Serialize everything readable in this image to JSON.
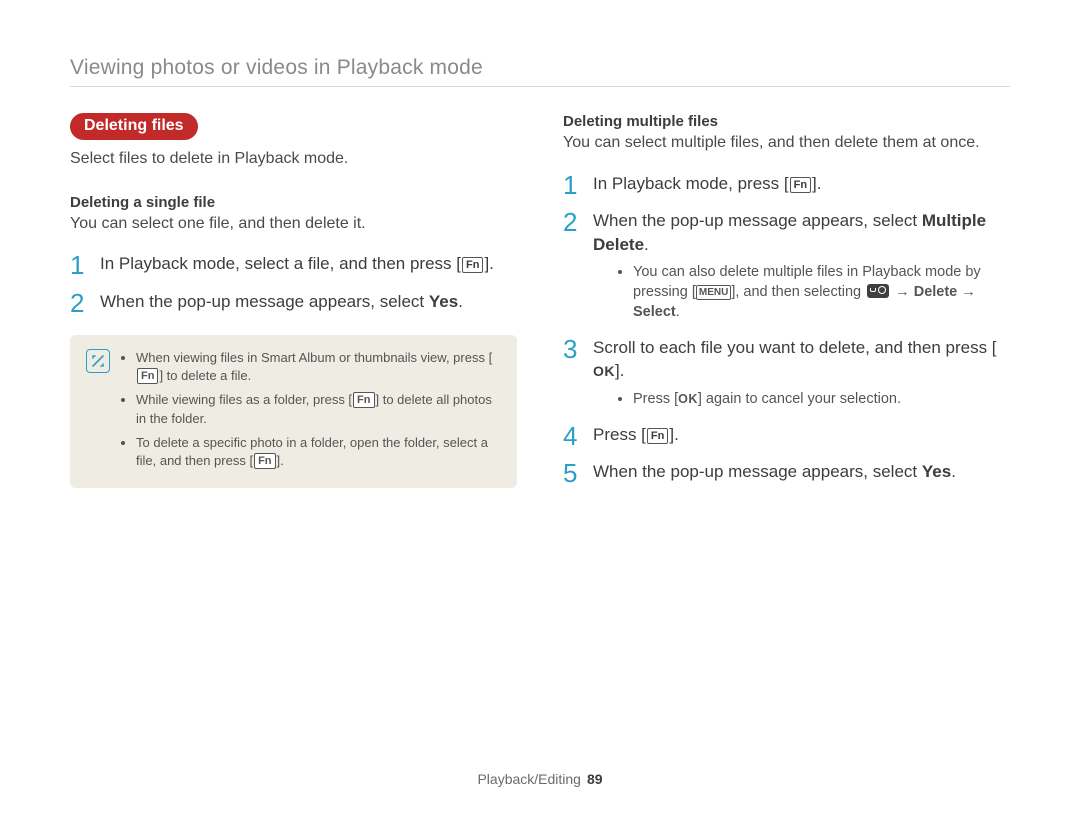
{
  "header": "Viewing photos or videos in Playback mode",
  "left": {
    "section_title": "Deleting files",
    "intro": "Select files to delete in Playback mode.",
    "sub1_title": "Deleting a single file",
    "sub1_text": "You can select one file, and then delete it.",
    "step1_a": "In Playback mode, select a file, and then press [",
    "step1_key": "Fn",
    "step1_b": "].",
    "step2_a": "When the pop-up message appears, select ",
    "step2_bold": "Yes",
    "step2_b": ".",
    "note1_a": "When viewing files in Smart Album or thumbnails view, press [",
    "note1_key": "Fn",
    "note1_b": "] to delete a file.",
    "note2_a": "While viewing files as a folder, press [",
    "note2_key": "Fn",
    "note2_b": "] to delete all photos in the folder.",
    "note3_a": "To delete a specific photo in a folder, open the folder, select a file, and then press [",
    "note3_key": "Fn",
    "note3_b": "]."
  },
  "right": {
    "sub_title": "Deleting multiple files",
    "sub_text": "You can select multiple files, and then delete them at once.",
    "s1_a": "In Playback mode, press [",
    "s1_key": "Fn",
    "s1_b": "].",
    "s2_a": "When the pop-up message appears, select ",
    "s2_bold": "Multiple Delete",
    "s2_b": ".",
    "s2_sub_a": "You can also delete multiple files in Playback mode by pressing [",
    "s2_sub_menu": "MENU",
    "s2_sub_b": "], and then selecting ",
    "s2_sub_arrow1": " → ",
    "s2_sub_delete": "Delete",
    "s2_sub_arrow2": " → ",
    "s2_sub_select": "Select",
    "s2_sub_c": ".",
    "s3_a": "Scroll to each file you want to delete, and then press [",
    "s3_ok": "OK",
    "s3_b": "].",
    "s3_sub_a": "Press [",
    "s3_sub_ok": "OK",
    "s3_sub_b": "] again to cancel your selection.",
    "s4_a": "Press [",
    "s4_key": "Fn",
    "s4_b": "].",
    "s5_a": "When the pop-up message appears, select ",
    "s5_bold": "Yes",
    "s5_b": "."
  },
  "footer": {
    "section": "Playback/Editing",
    "page": "89"
  }
}
